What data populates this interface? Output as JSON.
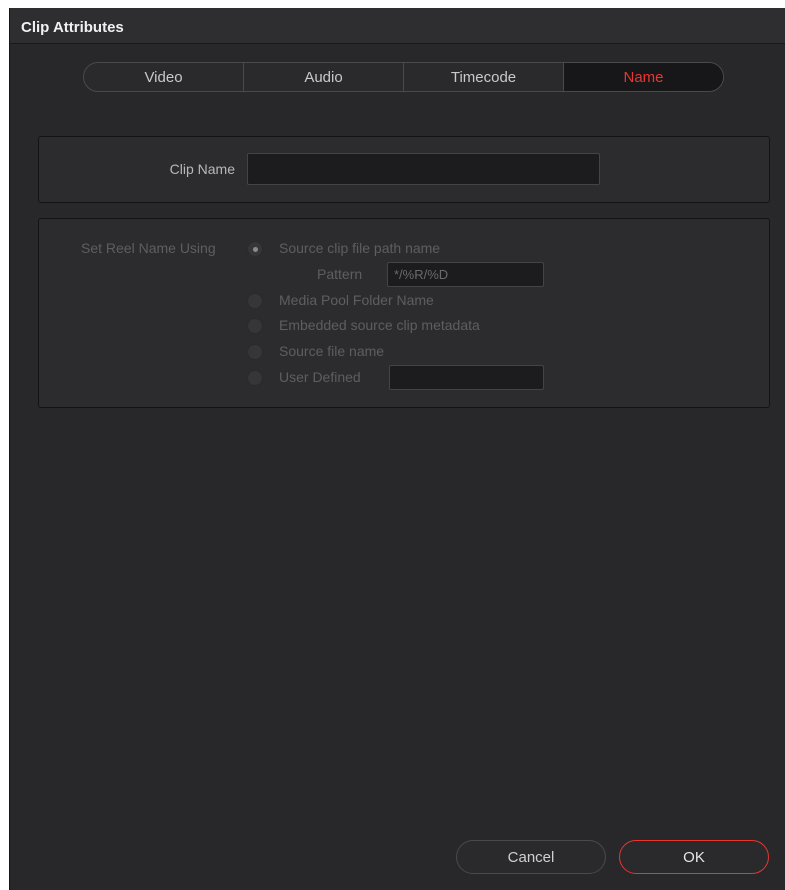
{
  "window": {
    "title": "Clip Attributes"
  },
  "tabs": [
    {
      "label": "Video"
    },
    {
      "label": "Audio"
    },
    {
      "label": "Timecode"
    },
    {
      "label": "Name",
      "active": true
    }
  ],
  "clip_name": {
    "label": "Clip Name",
    "value": ""
  },
  "reel": {
    "label": "Set Reel Name Using",
    "options": [
      {
        "label": "Source clip file path name",
        "selected": true
      },
      {
        "label": "Media Pool Folder Name",
        "selected": false
      },
      {
        "label": "Embedded source clip metadata",
        "selected": false
      },
      {
        "label": "Source file name",
        "selected": false
      },
      {
        "label": "User Defined",
        "selected": false
      }
    ],
    "pattern_label": "Pattern",
    "pattern_value": "*/%R/%D",
    "user_defined_value": ""
  },
  "buttons": {
    "cancel": "Cancel",
    "ok": "OK"
  },
  "colors": {
    "accent": "#e8362f",
    "background": "#28282b",
    "panel": "#2c2c2f"
  }
}
